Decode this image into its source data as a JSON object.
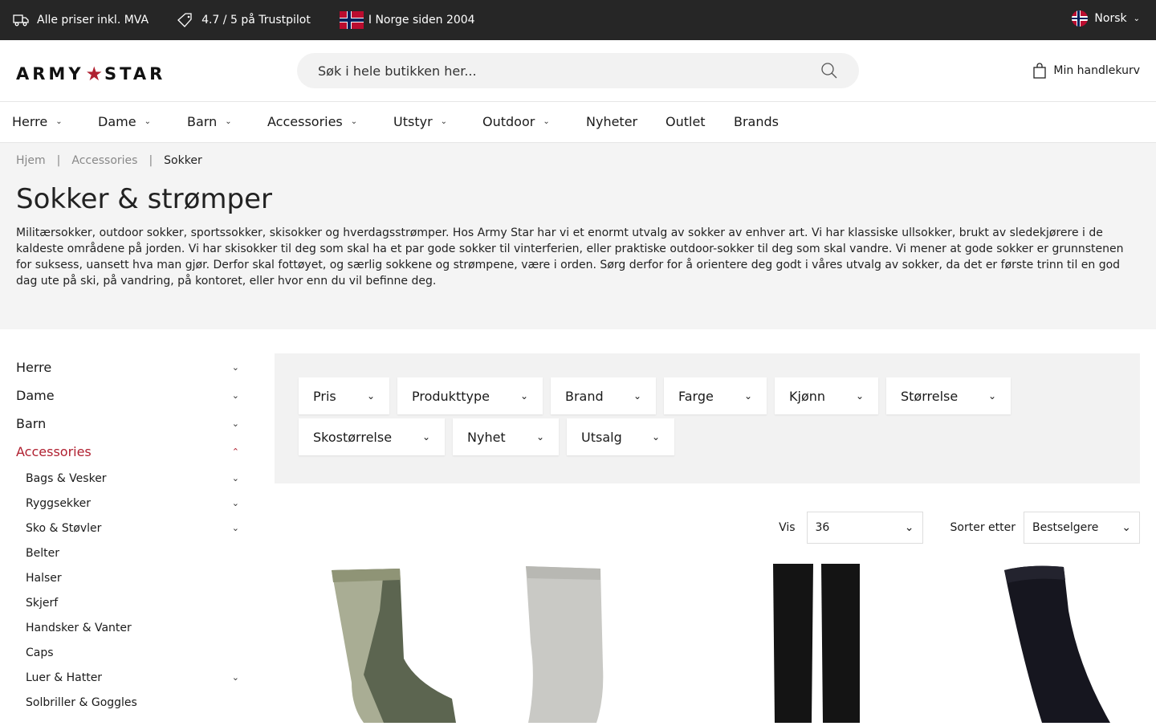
{
  "topbar": {
    "items": [
      {
        "icon": "truck-icon",
        "text": "Alle priser inkl. MVA"
      },
      {
        "icon": "tag-icon",
        "text": "4.7 / 5 på Trustpilot"
      },
      {
        "icon": "norway-flag-icon",
        "text": "I Norge siden 2004"
      }
    ],
    "language": "Norsk",
    "colors": {
      "background": "#262626",
      "text": "#ffffff"
    }
  },
  "header": {
    "logo_left": "ARMY",
    "logo_star": "★",
    "logo_right": "STAR",
    "search_placeholder": "Søk i hele butikken her...",
    "cart_label": "Min handlekurv"
  },
  "nav": {
    "items": [
      {
        "label": "Herre",
        "dropdown": true
      },
      {
        "label": "Dame",
        "dropdown": true
      },
      {
        "label": "Barn",
        "dropdown": true
      },
      {
        "label": "Accessories",
        "dropdown": true
      },
      {
        "label": "Utstyr",
        "dropdown": true
      },
      {
        "label": "Outdoor",
        "dropdown": true
      },
      {
        "label": "Nyheter",
        "dropdown": false
      },
      {
        "label": "Outlet",
        "dropdown": false
      },
      {
        "label": "Brands",
        "dropdown": false
      }
    ]
  },
  "breadcrumb": {
    "items": [
      "Hjem",
      "Accessories",
      "Sokker"
    ],
    "separator": "|"
  },
  "page": {
    "title": "Sokker & strømper",
    "description": "Militærsokker, outdoor sokker, sportssokker, skisokker og hverdagsstrømper. Hos Army Star har vi et enormt utvalg av sokker av enhver art. Vi har klassiske ullsokker, brukt av sledekjørere i de kaldeste områdene på jorden. Vi har skisokker til deg som skal ha et par gode sokker til vinterferien, eller praktiske outdoor-sokker til deg som skal vandre. Vi mener at gode sokker er grunnstenen for suksess, uansett hva man gjør. Derfor skal fottøyet, og særlig sokkene og strømpene, være i orden. Sørg derfor for å orientere deg godt i våres utvalg av sokker, da det er første trinn til en god dag ute på ski, på vandring, på kontoret, eller hvor enn du vil befinne deg."
  },
  "sidebar": {
    "main": [
      {
        "label": "Herre",
        "expanded": false
      },
      {
        "label": "Dame",
        "expanded": false
      },
      {
        "label": "Barn",
        "expanded": false
      },
      {
        "label": "Accessories",
        "expanded": true
      }
    ],
    "sub": [
      {
        "label": "Bags & Vesker",
        "dropdown": true
      },
      {
        "label": "Ryggsekker",
        "dropdown": true
      },
      {
        "label": "Sko & Støvler",
        "dropdown": true
      },
      {
        "label": "Belter",
        "dropdown": false
      },
      {
        "label": "Halser",
        "dropdown": false
      },
      {
        "label": "Skjerf",
        "dropdown": false
      },
      {
        "label": "Handsker & Vanter",
        "dropdown": false
      },
      {
        "label": "Caps",
        "dropdown": false
      },
      {
        "label": "Luer & Hatter",
        "dropdown": true
      },
      {
        "label": "Solbriller & Goggles",
        "dropdown": false
      }
    ],
    "active_color": "#b02030"
  },
  "filters": {
    "row1": [
      "Pris",
      "Produkttype",
      "Brand",
      "Farge",
      "Kjønn",
      "Størrelse"
    ],
    "row2": [
      "Skostørrelse",
      "Nyhet",
      "Utsalg"
    ]
  },
  "toolbar": {
    "show_label": "Vis",
    "show_value": "36",
    "sort_label": "Sorter etter",
    "sort_value": "Bestselgere"
  },
  "products": [
    {
      "image": "green-hiking-sock"
    },
    {
      "image": "grey-wool-sock"
    },
    {
      "image": "black-long-socks-pair"
    },
    {
      "image": "black-sock"
    }
  ]
}
